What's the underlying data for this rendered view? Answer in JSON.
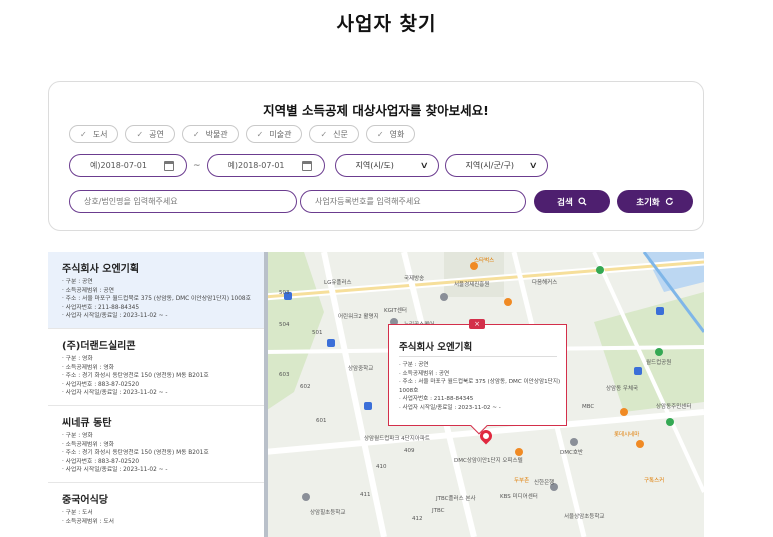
{
  "page": {
    "title": "사업자 찾기"
  },
  "search": {
    "heading": "지역별 소득공제 대상사업자를 찾아보세요!",
    "categories": [
      "도서",
      "공연",
      "박물관",
      "미술관",
      "신문",
      "영화"
    ],
    "date_from_placeholder": "예)2018-07-01",
    "date_to_placeholder": "예)2018-07-01",
    "date_separator": "~",
    "region1_label": "지역(시/도)",
    "region2_label": "지역(시/군/구)",
    "name_placeholder": "상호/법인명을 입력해주세요",
    "bizno_placeholder": "사업자등록번호를 입력해주세요",
    "search_button": "검색",
    "reset_button": "초기화"
  },
  "results": [
    {
      "name": "주식회사 오엔기획",
      "lines": [
        "· 구분 : 공연",
        "· 소득공제범위 : 공연",
        "· 주소 : 서울 마포구 월드컵북로 375 (상암동, DMC 이안상암1단지) 1008호",
        "· 사업자번호 : 211-88-84345",
        "· 사업자 시작일/종료일 : 2023-11-02 ~ -"
      ]
    },
    {
      "name": "(주)더랜드실리콘",
      "lines": [
        "· 구분 : 영화",
        "· 소득공제범위 : 영화",
        "· 주소 : 경기 화성시 동탄영천로 150 (영천동) M동 B201호",
        "· 사업자번호 : 883-87-02520",
        "· 사업자 시작일/종료일 : 2023-11-02 ~ -"
      ]
    },
    {
      "name": "씨네큐 동탄",
      "lines": [
        "· 구분 : 영화",
        "· 소득공제범위 : 영화",
        "· 주소 : 경기 화성시 동탄영천로 150 (영천동) M동 B201호",
        "· 사업자번호 : 883-87-02520",
        "· 사업자 시작일/종료일 : 2023-11-02 ~ -"
      ]
    },
    {
      "name": "중국어식당",
      "lines": [
        "· 구분 : 도서",
        "· 소득공제범위 : 도서"
      ]
    }
  ],
  "popup": {
    "close": "×",
    "title": "주식회사 오엔기획",
    "lines": [
      "· 구분 : 공연",
      "· 소득공제범위 : 공연",
      "· 주소 : 서울 마포구 월드컵북로 375 (상암동, DMC 이안상암1단지)",
      "  1008호",
      "· 사업자번호 : 211-88-84345",
      "· 사업자 시작일/종료일 : 2023-11-02 ~ -"
    ]
  },
  "map": {
    "labels": {
      "l1": "LG유플러스",
      "l2": "국제방송",
      "l3": "서울경제진흥원",
      "l4": "다음해커스",
      "l5": "KGIT센터",
      "l6": "어린워크2 활명지",
      "l7": "누리꿈스퀘어",
      "l8": "상암중학교",
      "l9": "상암월드컵파크 4단지아파트",
      "l10": "DMC상암이안1단지 오피스텔",
      "l11": "JTBC플러스 본사",
      "l12": "JTBC",
      "l13": "KBS 미디어센터",
      "l14": "신한은행",
      "l15": "서울상암초등학교",
      "l16": "DMC호반",
      "l17": "상암동 우체국",
      "l18": "상암동주민센터",
      "l19": "MBC",
      "l20": "월드컵공원",
      "l21": "상암힐초등학교",
      "l22": "스타벅스",
      "l23": "두부촌",
      "l24": "구톡스커",
      "l25": "롯데시네마",
      "n1": "503",
      "n2": "501",
      "n3": "504",
      "n4": "602",
      "n5": "603",
      "n6": "601",
      "n7": "410",
      "n8": "412",
      "n9": "411",
      "n10": "409"
    }
  }
}
